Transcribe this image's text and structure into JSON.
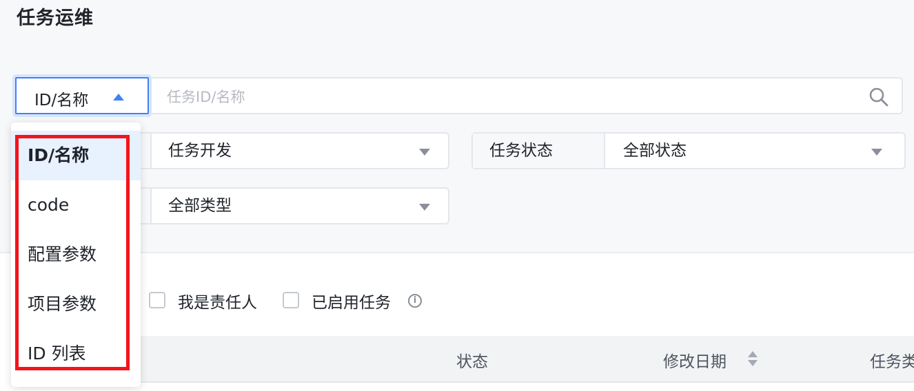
{
  "page": {
    "title": "任务运维"
  },
  "search": {
    "type_selected": "ID/名称",
    "placeholder": "任务ID/名称",
    "value": ""
  },
  "filters": {
    "project": {
      "value": "任务开发"
    },
    "status": {
      "label": "任务状态",
      "value": "全部状态"
    },
    "type": {
      "value": "全部类型"
    }
  },
  "dropdown": {
    "items": [
      {
        "label": "ID/名称",
        "selected": true
      },
      {
        "label": "code",
        "selected": false
      },
      {
        "label": "配置参数",
        "selected": false
      },
      {
        "label": "项目参数",
        "selected": false
      },
      {
        "label": "ID 列表",
        "selected": false
      }
    ]
  },
  "checkboxes": {
    "owner": {
      "label": "我是责任人",
      "checked": false
    },
    "enabled": {
      "label": "已启用任务",
      "checked": false
    }
  },
  "table": {
    "columns": [
      "状态",
      "修改日期",
      "任务类"
    ]
  },
  "colors": {
    "accent": "#3f82f6",
    "highlight": "#f5141b",
    "selected_bg": "#e8f1fe"
  }
}
